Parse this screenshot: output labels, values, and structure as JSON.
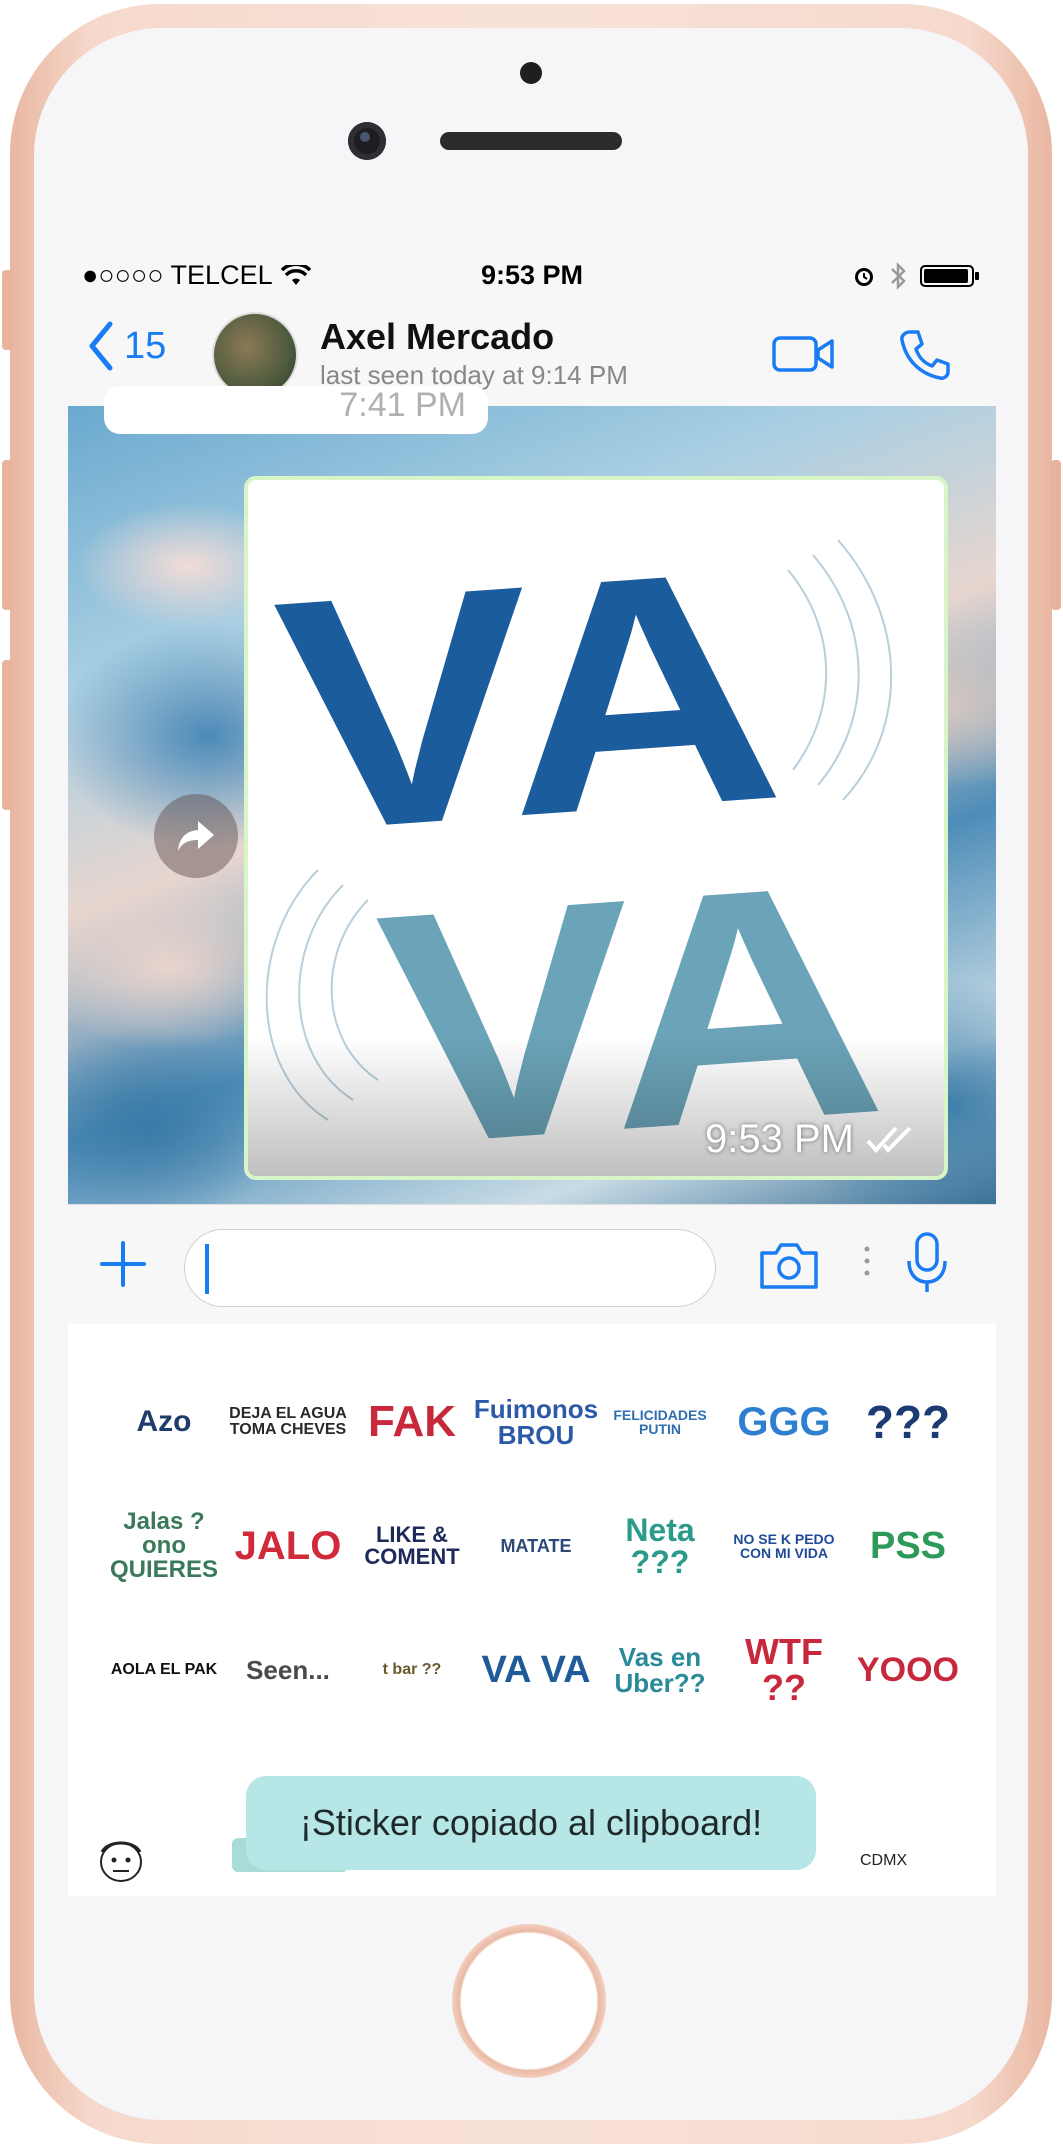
{
  "status_bar": {
    "carrier": "●○○○○ TELCEL",
    "time": "9:53 PM"
  },
  "header": {
    "back_count": "15",
    "contact_name": "Axel Mercado",
    "last_seen": "last seen today at 9:14 PM"
  },
  "chat": {
    "previous_message_time": "7:41 PM",
    "sticker": {
      "line1": "VA",
      "line2": "VA",
      "time": "9:53 PM"
    }
  },
  "keyboard": {
    "stickers": [
      {
        "text": "Azo",
        "color": "#1f3d6b"
      },
      {
        "text": "DEJA EL AGUA TOMA CHEVES",
        "color": "#2a2a2a"
      },
      {
        "text": "FAK",
        "color": "#c8283c"
      },
      {
        "text": "Fuimonos BROU",
        "color": "#2b5aa8"
      },
      {
        "text": "FELICIDADES PUTIN",
        "color": "#2e6fb0"
      },
      {
        "text": "GGG",
        "color": "#2f7fd0"
      },
      {
        "text": "???",
        "color": "#1c3b73"
      },
      {
        "text": "Jalas ? ono QUIERES",
        "color": "#3a7a5a"
      },
      {
        "text": "JALO",
        "color": "#d12a3a"
      },
      {
        "text": "LIKE & COMENT",
        "color": "#1f2a5a"
      },
      {
        "text": "MATATE",
        "color": "#2c4a78"
      },
      {
        "text": "Neta ???",
        "color": "#2a9a8a"
      },
      {
        "text": "NO SE K PEDO CON MI VIDA",
        "color": "#1f4a9a"
      },
      {
        "text": "PSS",
        "color": "#2e9a5a"
      },
      {
        "text": "AOLA EL PAK",
        "color": "#111111"
      },
      {
        "text": "Seen...",
        "color": "#4a4a4a"
      },
      {
        "text": "t bar ??",
        "color": "#6a5a2a"
      },
      {
        "text": "VA VA",
        "color": "#1f5a9a"
      },
      {
        "text": "Vas en Uber??",
        "color": "#2a8a9a"
      },
      {
        "text": "WTF ??",
        "color": "#c8283c"
      },
      {
        "text": "YOOO",
        "color": "#c8283c"
      }
    ],
    "toast": "¡Sticker copiado al clipboard!",
    "region_label": "CDMX"
  },
  "colors": {
    "ios_blue": "#1a7cf3",
    "sticker_border": "#d8f5c8",
    "toast_bg": "#b6e6e5",
    "vava_dark": "#1b5c9c",
    "vava_light": "#6ba3b8"
  }
}
